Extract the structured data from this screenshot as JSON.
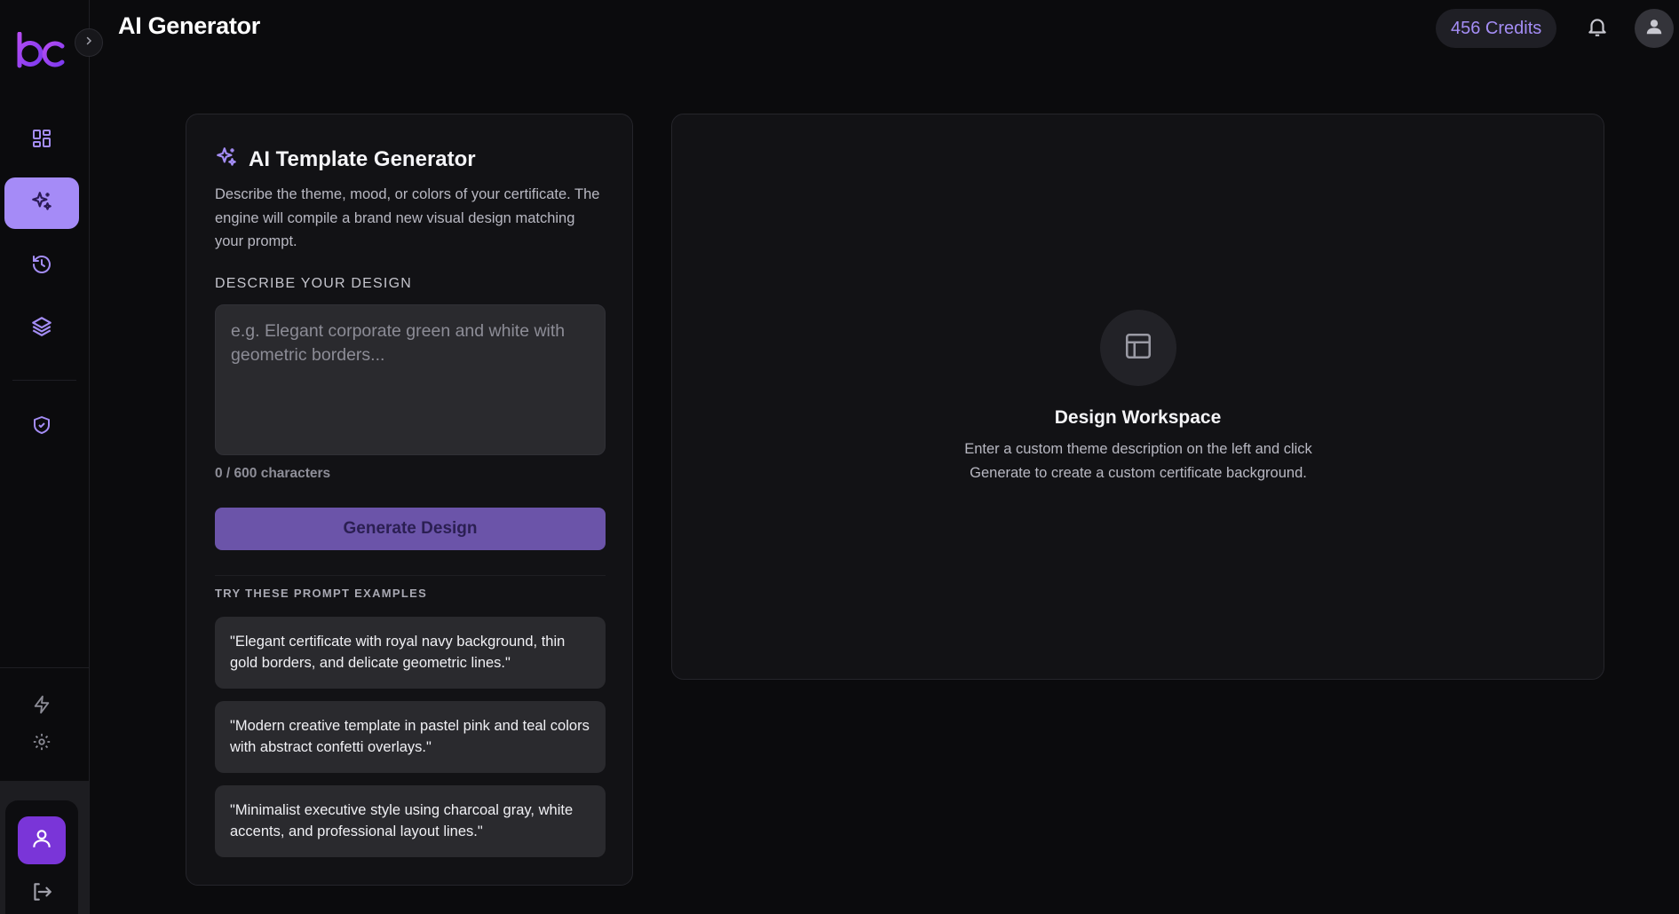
{
  "app": {
    "logo_text": "bc",
    "colors": {
      "accent": "#a58bf7",
      "brand": "#8b3ef0",
      "background": "#0b0b0d",
      "card": "#121215"
    }
  },
  "header": {
    "title": "AI Generator",
    "credits": "456 Credits",
    "notification_icon": "bell-icon",
    "profile_icon": "user-icon"
  },
  "sidebar": {
    "items": [
      {
        "id": "dashboard",
        "icon": "grid-icon",
        "active": false
      },
      {
        "id": "ai-generator",
        "icon": "sparkles-icon",
        "active": true
      },
      {
        "id": "history",
        "icon": "history-icon",
        "active": false
      },
      {
        "id": "templates",
        "icon": "layers-icon",
        "active": false
      },
      {
        "id": "verification",
        "icon": "shield-check-icon",
        "active": false
      }
    ],
    "bottom_items": [
      {
        "id": "upgrade",
        "icon": "bolt-icon"
      },
      {
        "id": "settings",
        "icon": "gear-icon"
      }
    ],
    "user_icon": "user-icon",
    "logout_icon": "logout-icon"
  },
  "generator": {
    "title": "AI Template Generator",
    "description": "Describe the theme, mood, or colors of your certificate. The engine will compile a brand new visual design matching your prompt.",
    "input_label": "DESCRIBE YOUR DESIGN",
    "input_placeholder": "e.g. Elegant corporate green and white with geometric borders...",
    "input_value": "",
    "char_count": "0 / 600 characters",
    "generate_label": "Generate Design",
    "examples_label": "TRY THESE PROMPT EXAMPLES",
    "examples": [
      "\"Elegant certificate with royal navy background, thin gold borders, and delicate geometric lines.\"",
      "\"Modern creative template in pastel pink and teal colors with abstract confetti overlays.\"",
      "\"Minimalist executive style using charcoal gray, white accents, and professional layout lines.\""
    ]
  },
  "workspace": {
    "icon": "layout-icon",
    "title": "Design Workspace",
    "description": "Enter a custom theme description on the left and click Generate to create a custom certificate background."
  }
}
